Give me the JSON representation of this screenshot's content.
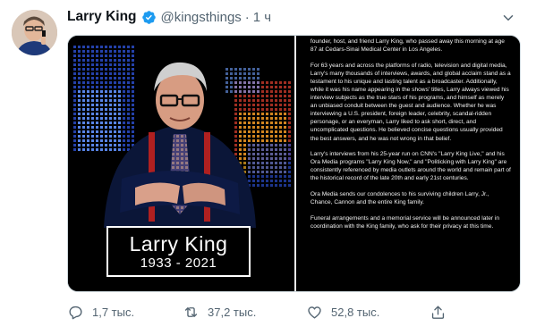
{
  "tweet": {
    "author_name": "Larry King",
    "handle": "@kingsthings",
    "separator": "·",
    "time": "1 ч",
    "avatar": "avatar-photo",
    "verified_color": "#1d9bf0",
    "media": {
      "name_card": {
        "name": "Larry King",
        "years": "1933 - 2021"
      },
      "statement": {
        "top_fragment": "founder, host, and friend Larry King, who passed away this morning at age 87 at Cedars-Sinai Medical Center in Los Angeles.",
        "paragraphs": [
          "For 63 years and across the platforms of radio, television and digital media, Larry's many thousands of interviews, awards, and global acclaim stand as a testament to his unique and lasting talent as a broadcaster. Additionally, while it was his name appearing in the shows' titles, Larry always viewed his interview subjects as the true stars of his programs, and himself as merely an unbiased conduit between the guest and audience. Whether he was interviewing a U.S. president, foreign leader, celebrity, scandal-ridden personage, or an everyman, Larry liked to ask short, direct, and uncomplicated questions. He believed concise questions usually provided the best answers, and he was not wrong in that belief.",
          "Larry's interviews from his 25-year run on CNN's \"Larry King Live,\" and his Ora Media programs \"Larry King Now,\" and \"Politicking with Larry King\" are consistently referenced by media outlets around the world and remain part of the historical record of the late 20th and early 21st centuries.",
          "Ora Media sends our condolences to his surviving children Larry, Jr., Chance, Cannon and the entire King family.",
          "Funeral arrangements and a memorial service will be announced later in coordination with the King family, who ask for their privacy at this time."
        ]
      }
    },
    "actions": {
      "reply": {
        "icon": "reply-icon",
        "count": "1,7 тыс."
      },
      "retweet": {
        "icon": "retweet-icon",
        "count": "37,2 тыс."
      },
      "like": {
        "icon": "heart-icon",
        "count": "52,8 тыс."
      },
      "share": {
        "icon": "share-icon"
      }
    }
  }
}
